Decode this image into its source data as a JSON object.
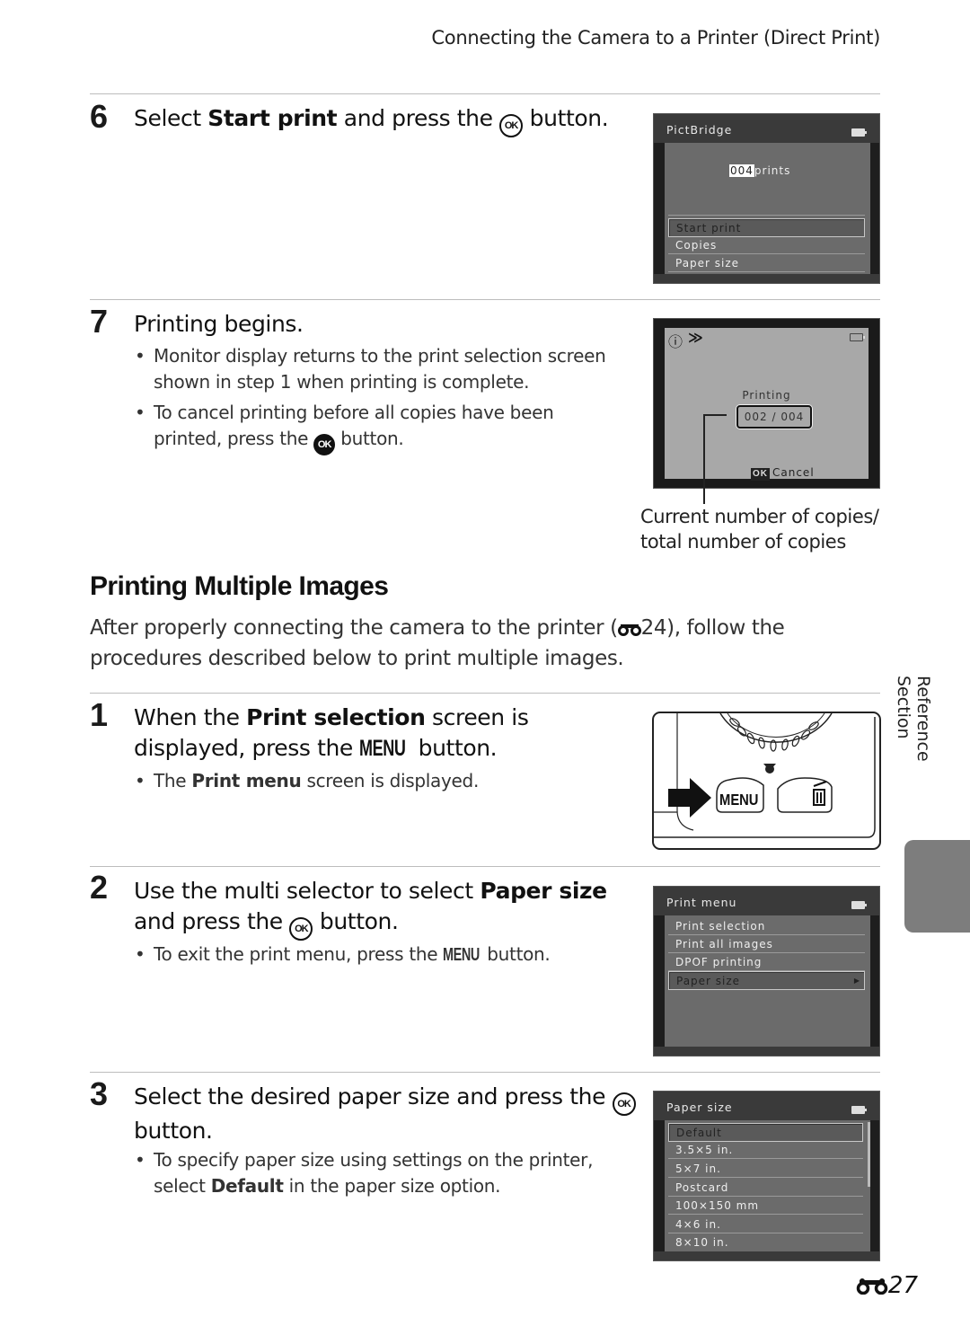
{
  "running_head": "Connecting the Camera to a Printer (Direct Print)",
  "step6": {
    "number": "6",
    "title_pre": "Select ",
    "title_bold": "Start print",
    "title_mid": " and press the ",
    "ok_icon": "OK",
    "title_post": " button.",
    "screen": {
      "header": "PictBridge",
      "count_value": "004",
      "count_label": "prints",
      "items": [
        "Start print",
        "Copies",
        "Paper size"
      ],
      "selected_index": 0
    }
  },
  "step7": {
    "number": "7",
    "title": "Printing begins.",
    "bullets": [
      {
        "text": "Monitor display returns to the print selection screen shown in step 1 when printing is complete."
      },
      {
        "text_pre": "To cancel printing before all copies have been printed, press the ",
        "ok_icon": "OK",
        "text_post": " button."
      }
    ],
    "screen": {
      "status": "Printing",
      "current": "002",
      "separator": "/",
      "total": "004",
      "ok_badge": "OK",
      "cancel_label": "Cancel"
    },
    "callout": [
      "Current number of copies/",
      "total number of copies"
    ]
  },
  "section": {
    "title": "Printing Multiple Images",
    "intro_pre": "After properly connecting the camera to the printer (",
    "intro_ref": "24",
    "intro_post": "), follow the procedures described below to print multiple images."
  },
  "step1": {
    "number": "1",
    "title_pre": "When the ",
    "title_bold": "Print selection",
    "title_mid": " screen is displayed, press the ",
    "menu_glyph": "MENU",
    "title_post": " button.",
    "bullet_pre": "The ",
    "bullet_bold": "Print menu",
    "bullet_post": " screen is displayed.",
    "illustration": {
      "menu_label": "MENU"
    }
  },
  "step2": {
    "number": "2",
    "title_pre": "Use the multi selector to select ",
    "title_bold": "Paper size",
    "title_mid": " and press the ",
    "ok_icon": "OK",
    "title_post": " button.",
    "bullet_pre": "To exit the print menu, press the ",
    "menu_glyph": "MENU",
    "bullet_post": " button.",
    "screen": {
      "header": "Print menu",
      "items": [
        "Print selection",
        "Print all images",
        "DPOF printing",
        "Paper size"
      ],
      "selected_index": 3
    }
  },
  "step3": {
    "number": "3",
    "title_pre": "Select the desired paper size and press the ",
    "ok_icon": "OK",
    "title_post": " button.",
    "bullet_pre": "To specify paper size using settings on the printer, select ",
    "bullet_bold": "Default",
    "bullet_post": " in the paper size option.",
    "screen": {
      "header": "Paper size",
      "items": [
        "Default",
        "3.5×5 in.",
        "5×7 in.",
        "Postcard",
        "100×150 mm",
        "4×6 in.",
        "8×10 in."
      ],
      "selected_index": 0
    }
  },
  "side_label": "Reference Section",
  "page_number": "27"
}
